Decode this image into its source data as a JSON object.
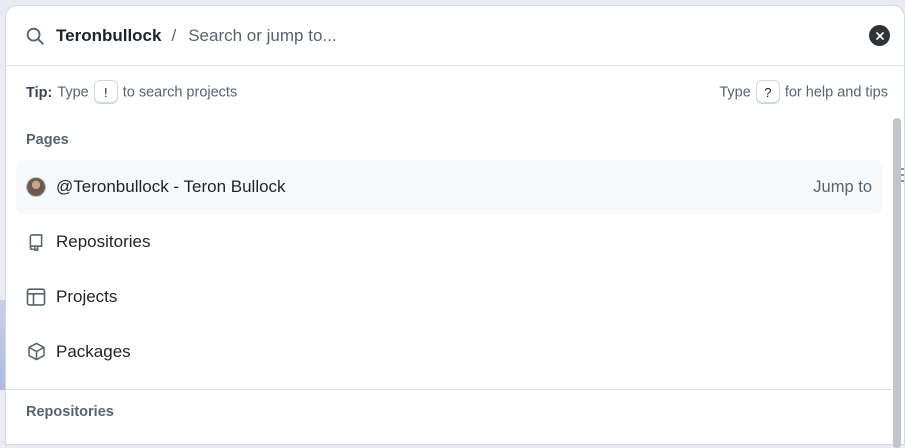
{
  "search": {
    "scope": "Teronbullock",
    "separator": "/",
    "placeholder": "Search or jump to..."
  },
  "tips": {
    "left_prefix": "Tip:",
    "left_type": "Type",
    "left_key": "!",
    "left_suffix": "to search projects",
    "right_type": "Type",
    "right_key": "?",
    "right_suffix": "for help and tips"
  },
  "sections": {
    "pages_title": "Pages",
    "repositories_title": "Repositories"
  },
  "pages": [
    {
      "label": "@Teronbullock - Teron Bullock",
      "hint": "Jump to",
      "icon": "avatar"
    },
    {
      "label": "Repositories",
      "icon": "repo-icon"
    },
    {
      "label": "Projects",
      "icon": "table-icon"
    },
    {
      "label": "Packages",
      "icon": "package-icon"
    }
  ]
}
